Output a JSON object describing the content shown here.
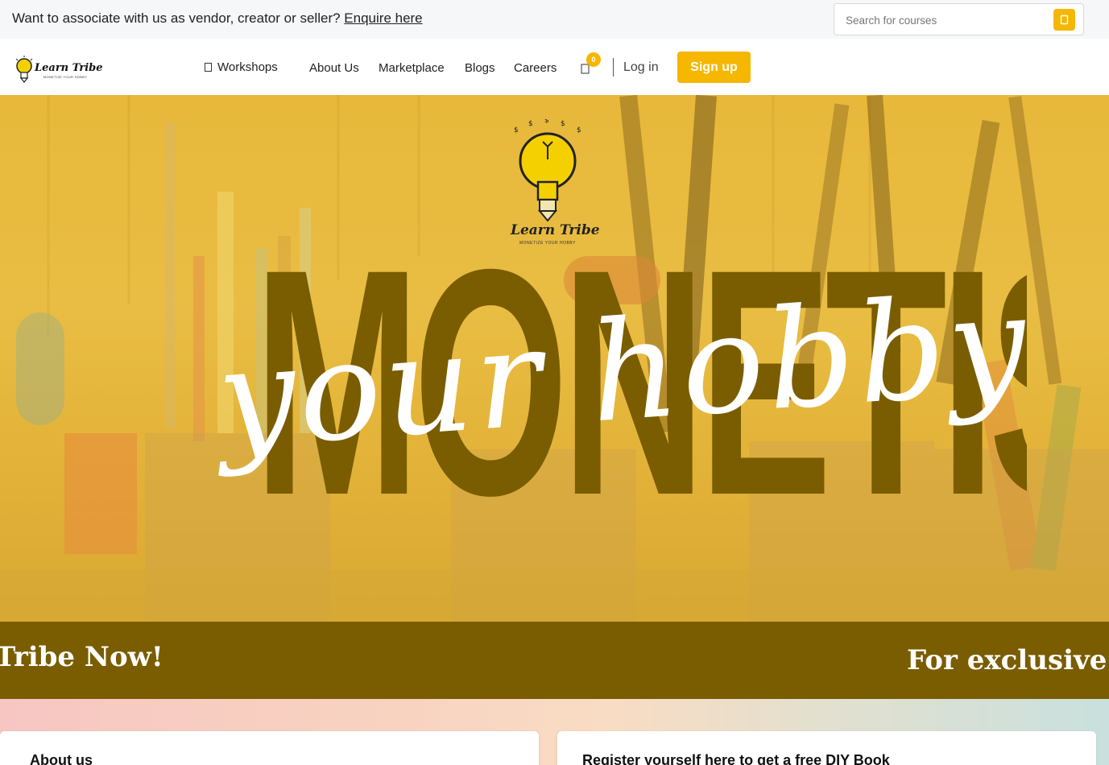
{
  "topbar": {
    "promo_text": "Want to associate with us as vendor, creator or seller?",
    "promo_link": "Enquire here",
    "search_placeholder": "Search for courses",
    "search_icon": "search-icon"
  },
  "brand": {
    "name": "Learn Tribe",
    "tagline": "MONETIZE YOUR HOBBY"
  },
  "nav": {
    "workshops": "Workshops",
    "workshops_icon": "grid-icon",
    "about": "About Us",
    "marketplace": "Marketplace",
    "blogs": "Blogs",
    "careers": "Careers",
    "cart_icon": "cart-icon",
    "cart_count": "0",
    "login": "Log in",
    "signup": "Sign up"
  },
  "hero": {
    "logo_name": "Learn Tribe",
    "logo_tagline": "MONETIZE YOUR HOBBY",
    "headline": "MONETISE",
    "script": "your hobby"
  },
  "marquee": {
    "item_1": "Tribe Now!",
    "item_2": "For exclusive w"
  },
  "sections": {
    "about_title": "About us",
    "register_title": "Register yourself here to get a free DIY Book"
  },
  "colors": {
    "accent": "#f5b700",
    "dark_olive": "#7a5d00",
    "hero_yellow": "#e7b83a"
  }
}
